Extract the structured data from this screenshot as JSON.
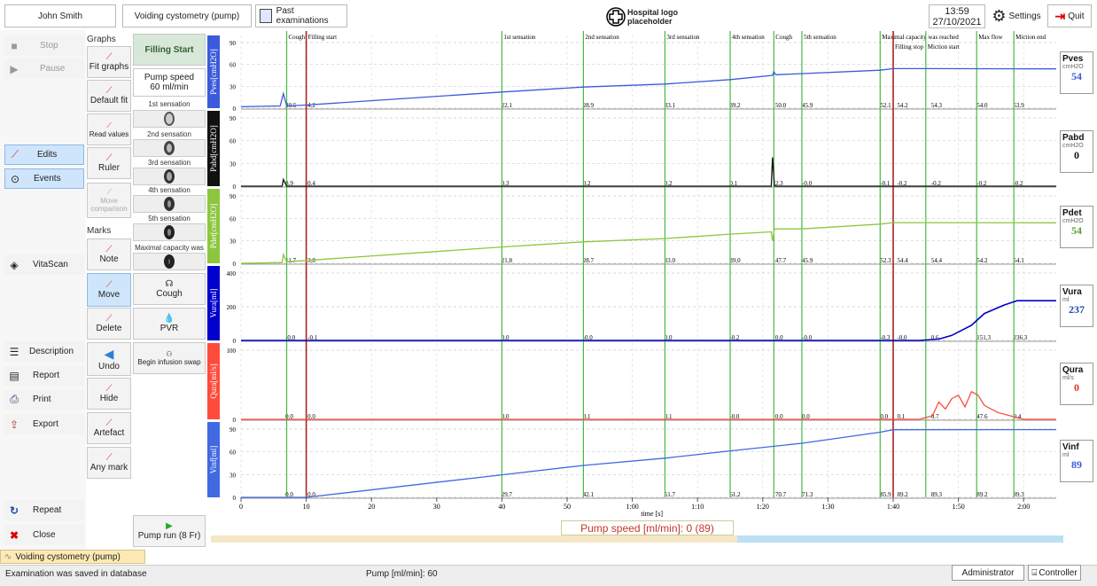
{
  "header": {
    "patient": "John Smith",
    "exam_type": "Voiding cystometry (pump)",
    "past_exams": "Past examinations",
    "logo": "Hospital logo placeholder",
    "time": "13:59",
    "date": "27/10/2021",
    "settings": "Settings",
    "quit": "Quit"
  },
  "left": {
    "stop": "Stop",
    "pause": "Pause",
    "edits": "Edits",
    "events": "Events",
    "vitascan": "VitaScan",
    "description": "Description",
    "report": "Report",
    "print": "Print",
    "export": "Export",
    "repeat": "Repeat",
    "close": "Close"
  },
  "graphs": {
    "section": "Graphs",
    "fit": "Fit graphs",
    "default": "Default fit",
    "read": "Read values",
    "ruler": "Ruler",
    "move_comp": "Move comparison"
  },
  "marks": {
    "section": "Marks",
    "note": "Note",
    "move": "Move",
    "delete": "Delete",
    "undo": "Undo",
    "hide": "Hide",
    "artefact": "Artefact",
    "any": "Any mark"
  },
  "events": {
    "filling_start": "Filling Start",
    "pump_speed": "Pump speed 60 ml/min",
    "s1": "1st sensation",
    "s2": "2nd sensation",
    "s3": "3rd sensation",
    "s4": "4th sensation",
    "s5": "5th sensation",
    "maxcap": "Maximal capacity was",
    "cough": "Cough",
    "pvr": "PVR",
    "infusion": "Begin infusion swap",
    "pump_run": "Pump run (8 Fr)"
  },
  "channels": [
    {
      "axis": "Pves[cmH2O]",
      "name": "Pves",
      "unit": "cmH2O",
      "value": "54",
      "color": "#3b5bdb",
      "vcolor": "#3b5bdb",
      "ticks": [
        "90",
        "60",
        "30",
        "0"
      ],
      "labels": [
        "20.5",
        "4.2",
        "22.1",
        "28.9",
        "33.1",
        "39.2",
        "50.0",
        "45.9",
        "52.1",
        "54.2",
        "54.3",
        "54.0",
        "53.9"
      ]
    },
    {
      "axis": "Pabd[cmH2O]",
      "name": "Pabd",
      "unit": "cmH2O",
      "value": "0",
      "color": "#111",
      "vcolor": "#111",
      "ticks": [
        "90",
        "60",
        "30",
        "0"
      ],
      "labels": [
        "8.9",
        "0.4",
        "0.3",
        "0.2",
        "0.2",
        "0.1",
        "2.3",
        "-0.0",
        "-0.1",
        "-0.2",
        "-0.2",
        "-0.2",
        "-0.2"
      ]
    },
    {
      "axis": "Pdet[cmH2O]",
      "name": "Pdet",
      "unit": "cmH2O",
      "value": "54",
      "color": "#8cc63f",
      "vcolor": "#5aa02c",
      "ticks": [
        "90",
        "60",
        "30",
        "0"
      ],
      "labels": [
        "11.7",
        "3.8",
        "21.8",
        "28.7",
        "33.0",
        "39.0",
        "47.7",
        "45.9",
        "52.3",
        "54.4",
        "54.4",
        "54.2",
        "54.1"
      ]
    },
    {
      "axis": "Vura[ml]",
      "name": "Vura",
      "unit": "ml",
      "value": "237",
      "color": "#0000cc",
      "vcolor": "#1f4ea8",
      "ticks": [
        "400",
        "200",
        "0"
      ],
      "labels": [
        "-0.0",
        "-0.1",
        "0.0",
        "-0.0",
        "0.0",
        "-0.2",
        "0.0",
        "-0.0",
        "-0.3",
        "-0.0",
        "0.6",
        "151.3",
        "236.3"
      ]
    },
    {
      "axis": "Qura[ml/s]",
      "name": "Qura",
      "unit": "ml/s",
      "value": "0",
      "color": "#ff4b3a",
      "vcolor": "#e03020",
      "ticks": [
        "100",
        "0"
      ],
      "labels": [
        "0.0",
        "0.0",
        "0.0",
        "0.1",
        "0.1",
        "-0.0",
        "0.0",
        "0.0",
        "0.0",
        "0.1",
        "0.7",
        "47.6",
        "0.4"
      ]
    },
    {
      "axis": "Vinf[ml]",
      "name": "Vinf",
      "unit": "ml",
      "value": "89",
      "color": "#4169e1",
      "vcolor": "#3b5bdb",
      "ticks": [
        "90",
        "60",
        "30",
        "0"
      ],
      "labels": [
        "0.0",
        "0.0",
        "29.7",
        "42.1",
        "51.7",
        "61.2",
        "70.7",
        "71.3",
        "85.9",
        "89.2",
        "89.3",
        "89.2",
        "89.3"
      ]
    }
  ],
  "markers": [
    {
      "t": 7,
      "name": "Cough",
      "color": "#44bb44"
    },
    {
      "t": 10,
      "name": "Filling start",
      "color": "#aa2222"
    },
    {
      "t": 40,
      "name": "1st sensation",
      "color": "#44bb44"
    },
    {
      "t": 52.5,
      "name": "2nd sensation",
      "color": "#44bb44"
    },
    {
      "t": 65,
      "name": "3rd sensation",
      "color": "#44bb44"
    },
    {
      "t": 75,
      "name": "4th sensation",
      "color": "#44bb44"
    },
    {
      "t": 81.7,
      "name": "Cough",
      "color": "#44bb44"
    },
    {
      "t": 86,
      "name": "5th sensation",
      "color": "#44bb44"
    },
    {
      "t": 98,
      "name": "Maximal capacity was reached",
      "color": "#44bb44"
    },
    {
      "t": 100,
      "name": "Filling stop",
      "color": "#aa2222"
    },
    {
      "t": 105,
      "name": "Miction start",
      "color": "#44bb44"
    },
    {
      "t": 112.8,
      "name": "Max flow",
      "color": "#44bb44"
    },
    {
      "t": 118.5,
      "name": "Miction end",
      "color": "#44bb44"
    }
  ],
  "time_axis": {
    "label": "time [s]",
    "ticks": [
      "0",
      "10",
      "20",
      "30",
      "40",
      "50",
      "1:00",
      "1:10",
      "1:20",
      "1:30",
      "1:40",
      "1:50",
      "2:00"
    ]
  },
  "pump_status": "Pump speed [ml/min]: 0 (89)",
  "tabs": {
    "active": "Voiding cystometry (pump)"
  },
  "status": {
    "saved": "Examination was saved in database",
    "pump": "Pump [ml/min]: 60",
    "user": "Administrator",
    "controller": "Controller"
  }
}
